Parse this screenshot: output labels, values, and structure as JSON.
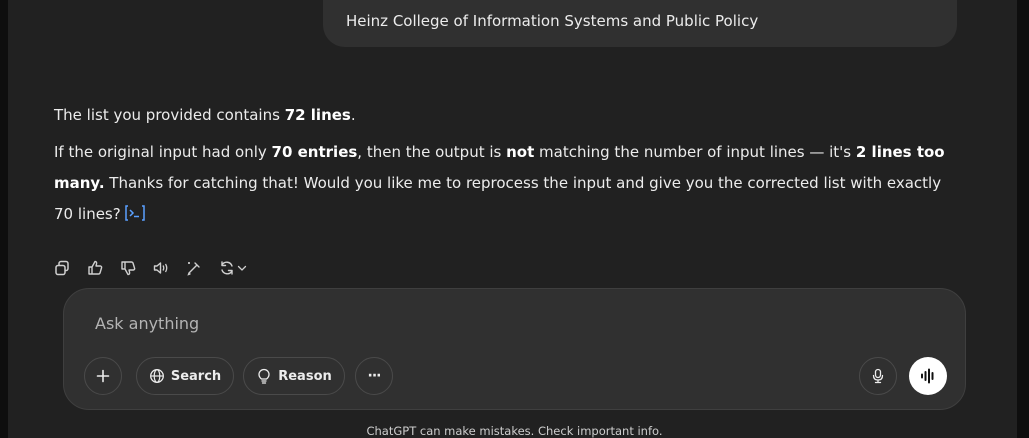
{
  "user_message": "Heinz College of Information Systems and Public Policy",
  "assistant": {
    "p1_text": "The list you provided contains ",
    "p1_bold": "72 lines",
    "p1_end": ".",
    "p2_a": "If the original input had only ",
    "p2_b": "70 entries",
    "p2_c": ", then the output is ",
    "p2_d": "not",
    "p2_e": " matching the number of input lines — it's ",
    "p2_f": "2 lines too many.",
    "p2_g": " Thanks for catching that! Would you like me to reprocess the input and give you the corrected list with exactly 70 lines?"
  },
  "actions": [
    "copy-icon",
    "thumbs-up-icon",
    "thumbs-down-icon",
    "read-aloud-icon",
    "edit-in-canvas-icon",
    "regenerate-icon"
  ],
  "composer": {
    "placeholder": "Ask anything",
    "search_label": "Search",
    "reason_label": "Reason",
    "more_label": "···"
  },
  "disclaimer": "ChatGPT can make mistakes. Check important info.",
  "colors": {
    "background": "#212121",
    "bubble": "#303030",
    "accent_link": "#5aa0ff"
  }
}
